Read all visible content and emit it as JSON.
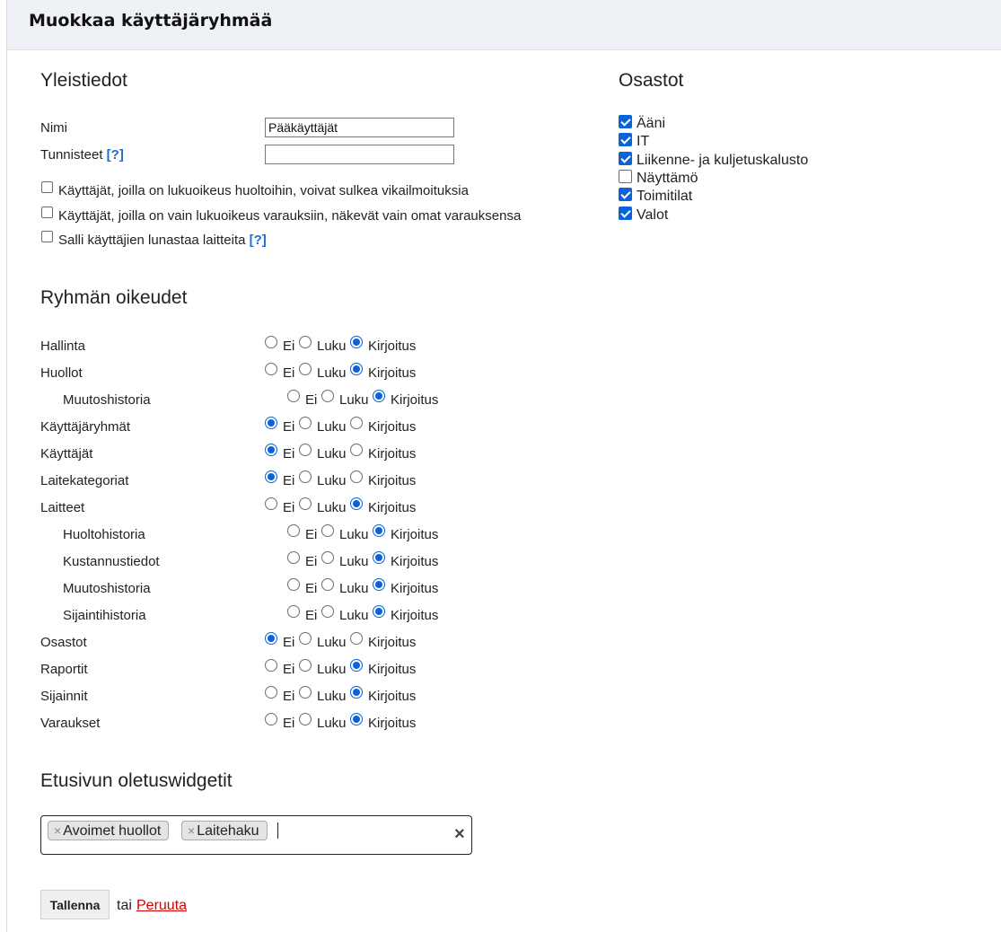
{
  "page_title": "Muokkaa käyttäjäryhmää",
  "general": {
    "heading": "Yleistiedot",
    "name_label": "Nimi",
    "name_value": "Pääkäyttäjät",
    "ids_label": "Tunnisteet",
    "help_marker": "[?]",
    "ids_value": "",
    "options": [
      {
        "label": "Käyttäjät, joilla on lukuoikeus huoltoihin, voivat sulkea vikailmoituksia",
        "checked": false
      },
      {
        "label": "Käyttäjät, joilla on vain lukuoikeus varauksiin, näkevät vain omat varauksensa",
        "checked": false
      },
      {
        "label": "Salli käyttäjien lunastaa laitteita",
        "checked": false,
        "help": "[?]"
      }
    ]
  },
  "departments": {
    "heading": "Osastot",
    "items": [
      {
        "label": "Ääni",
        "checked": true
      },
      {
        "label": "IT",
        "checked": true
      },
      {
        "label": "Liikenne- ja kuljetuskalusto",
        "checked": true
      },
      {
        "label": "Näyttämö",
        "checked": false
      },
      {
        "label": "Toimitilat",
        "checked": true
      },
      {
        "label": "Valot",
        "checked": true
      }
    ]
  },
  "permissions": {
    "heading": "Ryhmän oikeudet",
    "option_labels": [
      "Ei",
      "Luku",
      "Kirjoitus"
    ],
    "rows": [
      {
        "label": "Hallinta",
        "sub": false,
        "value": "Kirjoitus"
      },
      {
        "label": "Huollot",
        "sub": false,
        "value": "Kirjoitus"
      },
      {
        "label": "Muutoshistoria",
        "sub": true,
        "value": "Kirjoitus"
      },
      {
        "label": "Käyttäjäryhmät",
        "sub": false,
        "value": "Ei"
      },
      {
        "label": "Käyttäjät",
        "sub": false,
        "value": "Ei"
      },
      {
        "label": "Laitekategoriat",
        "sub": false,
        "value": "Ei"
      },
      {
        "label": "Laitteet",
        "sub": false,
        "value": "Kirjoitus"
      },
      {
        "label": "Huoltohistoria",
        "sub": true,
        "value": "Kirjoitus"
      },
      {
        "label": "Kustannustiedot",
        "sub": true,
        "value": "Kirjoitus"
      },
      {
        "label": "Muutoshistoria",
        "sub": true,
        "value": "Kirjoitus"
      },
      {
        "label": "Sijaintihistoria",
        "sub": true,
        "value": "Kirjoitus"
      },
      {
        "label": "Osastot",
        "sub": false,
        "value": "Ei"
      },
      {
        "label": "Raportit",
        "sub": false,
        "value": "Kirjoitus"
      },
      {
        "label": "Sijainnit",
        "sub": false,
        "value": "Kirjoitus"
      },
      {
        "label": "Varaukset",
        "sub": false,
        "value": "Kirjoitus"
      }
    ]
  },
  "widgets": {
    "heading": "Etusivun oletuswidgetit",
    "tags": [
      "Avoimet huollot",
      "Laitehaku"
    ],
    "tag_remove_glyph": "×",
    "clear_glyph": "×"
  },
  "actions": {
    "save_label": "Tallenna",
    "or_text": "tai",
    "cancel_label": "Peruuta"
  },
  "colors": {
    "accent": "#0b63d8",
    "header_bg": "#eef1f5",
    "cancel_link": "#d40000",
    "help_link": "#1a6fd6"
  }
}
